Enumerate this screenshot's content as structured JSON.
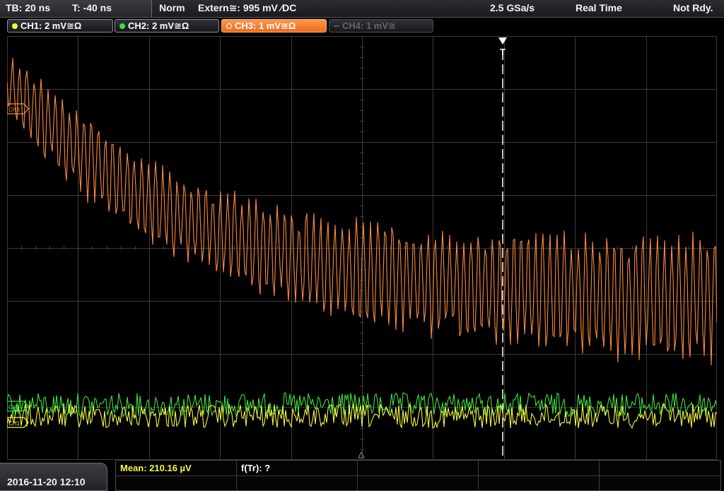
{
  "status_bar": {
    "timebase": "TB: 20 ns",
    "trigger_time": "T: -40 ns",
    "trigger_mode": "Norm",
    "trigger_source": "Extern≅: 995 mV ∕DC",
    "sample_rate": "2.5 GSa/s",
    "acq_mode": "Real Time",
    "status": "Not Rdy."
  },
  "channels": [
    {
      "label": "CH1: 2 mV≅Ω",
      "color": "#f5f542",
      "state": "on"
    },
    {
      "label": "CH2: 2 mV≅Ω",
      "color": "#3fe03f",
      "state": "on"
    },
    {
      "label": "CH3: 1 mV≅Ω",
      "color": "#ff8a3c",
      "state": "active"
    },
    {
      "label": "CH4: 1 mV≅",
      "color": "#666666",
      "state": "off"
    }
  ],
  "screen": {
    "grid_color": "#3a3a3a",
    "trigger_marker": "T",
    "markers": {
      "ch1": "CH1",
      "ch2": "CH2",
      "ch3": "CH3"
    }
  },
  "footer": {
    "datetime": "2016-11-20 12:10",
    "measurements": [
      {
        "label": "Mean: 210.16 µV",
        "color": "#f5f542"
      },
      {
        "label": "f(Tr): ?",
        "color": "#ffffff"
      }
    ]
  }
}
